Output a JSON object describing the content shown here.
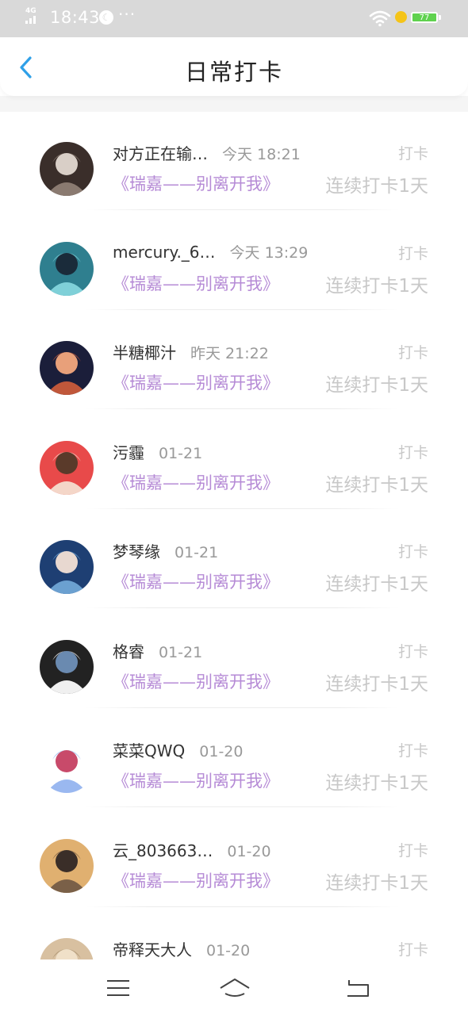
{
  "status_bar": {
    "network": "4G",
    "time": "18:43",
    "more": "···",
    "battery": "77"
  },
  "header": {
    "title": "日常打卡"
  },
  "checkins": [
    {
      "name": "对方正在输…",
      "time": "今天 18:21",
      "book": "《瑞嘉——别离开我》",
      "tag": "打卡",
      "streak": "连续打卡1天",
      "avatar_colors": [
        "#3a2e2a",
        "#8a7a70",
        "#d9cfc7"
      ]
    },
    {
      "name": "mercury._6…",
      "time": "今天 13:29",
      "book": "《瑞嘉——别离开我》",
      "tag": "打卡",
      "streak": "连续打卡1天",
      "avatar_colors": [
        "#2f7f8f",
        "#7fd0d8",
        "#1a2b3a"
      ]
    },
    {
      "name": "半糖椰汁",
      "time": "昨天 21:22",
      "book": "《瑞嘉——别离开我》",
      "tag": "打卡",
      "streak": "连续打卡1天",
      "avatar_colors": [
        "#1b1e3a",
        "#c0573a",
        "#e8a07a"
      ]
    },
    {
      "name": "污霾",
      "time": "01-21",
      "book": "《瑞嘉——别离开我》",
      "tag": "打卡",
      "streak": "连续打卡1天",
      "avatar_colors": [
        "#e84a4a",
        "#f4d6c8",
        "#5a3a2a"
      ]
    },
    {
      "name": "梦琴缘",
      "time": "01-21",
      "book": "《瑞嘉——别离开我》",
      "tag": "打卡",
      "streak": "连续打卡1天",
      "avatar_colors": [
        "#1e3f73",
        "#6ba0d0",
        "#e8d8d0"
      ]
    },
    {
      "name": "格睿",
      "time": "01-21",
      "book": "《瑞嘉——别离开我》",
      "tag": "打卡",
      "streak": "连续打卡1天",
      "avatar_colors": [
        "#222222",
        "#f0f0f0",
        "#6a8ab0"
      ]
    },
    {
      "name": "菜菜QWQ",
      "time": "01-20",
      "book": "《瑞嘉——别离开我》",
      "tag": "打卡",
      "streak": "连续打卡1天",
      "avatar_colors": [
        "#ffffff",
        "#9ab8f0",
        "#c84a6a"
      ]
    },
    {
      "name": "云_803663…",
      "time": "01-20",
      "book": "《瑞嘉——别离开我》",
      "tag": "打卡",
      "streak": "连续打卡1天",
      "avatar_colors": [
        "#e0b070",
        "#7a6048",
        "#3a2e28"
      ]
    },
    {
      "name": "帝释天大人",
      "time": "01-20",
      "book": "",
      "tag": "打卡",
      "streak": "",
      "avatar_colors": [
        "#d8c0a0",
        "#a89070",
        "#f0e0c8"
      ]
    }
  ],
  "colors": {
    "accent": "#2fa0e8",
    "book_title": "#b68bd6",
    "muted": "#c8c8c8"
  },
  "icons": {
    "back": "chevron-left-icon",
    "menu": "menu-icon",
    "home": "home-icon",
    "return": "return-icon"
  }
}
